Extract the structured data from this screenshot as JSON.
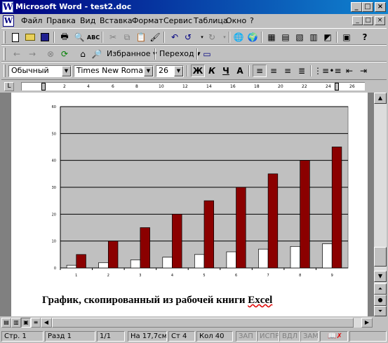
{
  "window": {
    "title": "Microsoft Word - test2.doc",
    "min": "_",
    "max": "□",
    "close": "×"
  },
  "menu": [
    "Файл",
    "Правка",
    "Вид",
    "Вставка",
    "Формат",
    "Сервис",
    "Таблица",
    "Окно",
    "?"
  ],
  "web_toolbar": {
    "favorites": "Избранное",
    "goto": "Переход"
  },
  "format_toolbar": {
    "style": "Обычный",
    "font": "Times New Roman",
    "size": "26",
    "bold": "Ж",
    "italic": "К",
    "underline": "Ч",
    "color_a": "А"
  },
  "ruler": {
    "ticks": [
      "2",
      "4",
      "6",
      "8",
      "10",
      "12",
      "14",
      "16",
      "18",
      "20",
      "22",
      "24",
      "26"
    ]
  },
  "caption": {
    "text": "График, скопированный из рабочей книги ",
    "err_word": "Excel"
  },
  "chart_data": {
    "type": "bar",
    "categories": [
      "1",
      "2",
      "3",
      "4",
      "5",
      "6",
      "7",
      "8",
      "9"
    ],
    "series": [
      {
        "values": [
          1,
          2,
          3,
          4,
          5,
          6,
          7,
          8,
          9
        ],
        "color": "#ffffff"
      },
      {
        "values": [
          5,
          10,
          15,
          20,
          25,
          30,
          35,
          40,
          45
        ],
        "color": "#8b0000"
      }
    ],
    "ylim": [
      0,
      60
    ],
    "yticks": [
      "0",
      "10",
      "20",
      "30",
      "40",
      "50",
      "60"
    ],
    "plot_bg": "#c0c0c0",
    "grid": true
  },
  "status": {
    "page": "Стр. 1",
    "section": "Разд 1",
    "pages": "1/1",
    "at": "На 17,7см",
    "line": "Ст 4",
    "col": "Кол 40",
    "rec": "ЗАП",
    "trk": "ИСПР",
    "ext": "ВДЛ",
    "ovr": "ЗАМ"
  }
}
